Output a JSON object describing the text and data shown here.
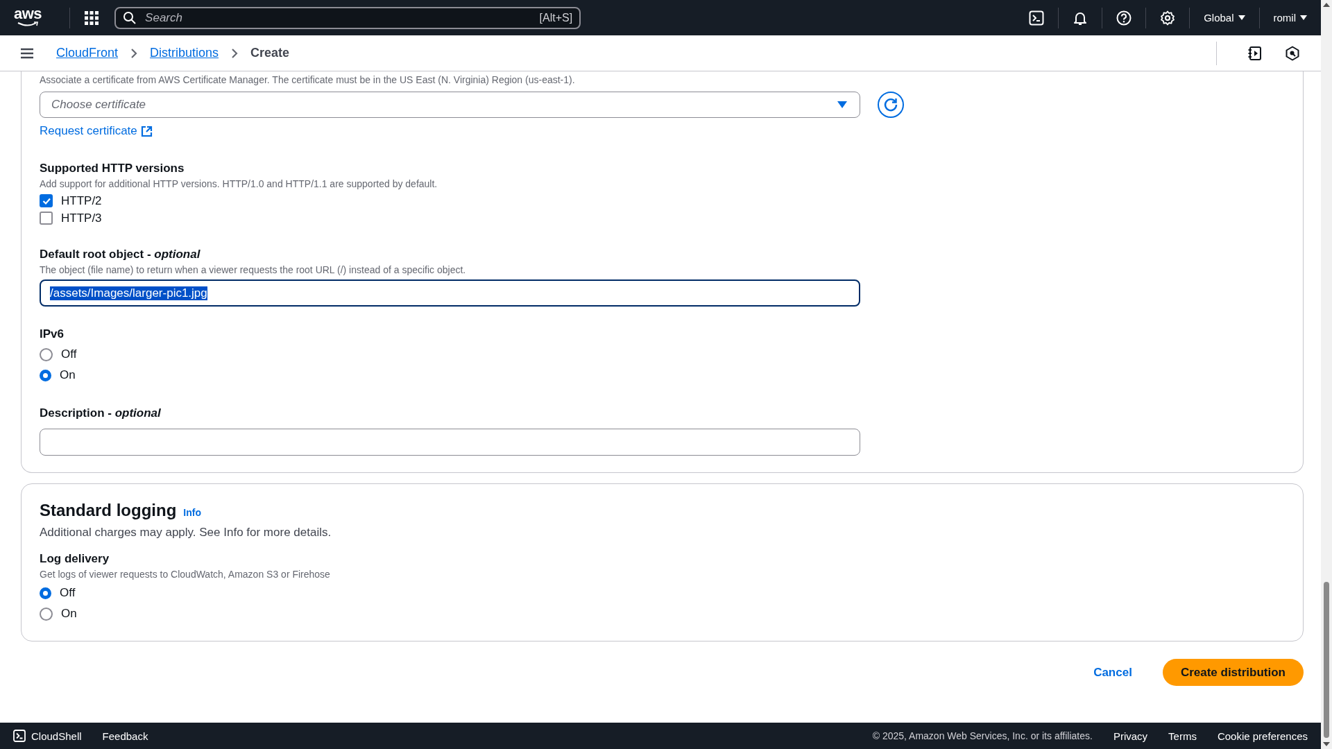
{
  "top_nav": {
    "logo": "aws",
    "search": {
      "placeholder": "Search",
      "shortcut": "[Alt+S]"
    },
    "region": "Global",
    "user": "romil"
  },
  "breadcrumbs": [
    {
      "label": "CloudFront",
      "kind": "link"
    },
    {
      "label": "Distributions",
      "kind": "link"
    },
    {
      "label": "Create",
      "kind": "current"
    }
  ],
  "settings_panel": {
    "certificate": {
      "description": "Associate a certificate from AWS Certificate Manager. The certificate must be in the US East (N. Virginia) Region (us-east-1).",
      "placeholder": "Choose certificate",
      "request_link": "Request certificate"
    },
    "http_versions": {
      "label": "Supported HTTP versions",
      "description": "Add support for additional HTTP versions. HTTP/1.0 and HTTP/1.1 are supported by default.",
      "options": [
        {
          "label": "HTTP/2",
          "checked": true
        },
        {
          "label": "HTTP/3",
          "checked": false
        }
      ]
    },
    "default_root_object": {
      "label": "Default root object - *optional*",
      "description": "The object (file name) to return when a viewer requests the root URL (/) instead of a specific object.",
      "value": "/assets/Images/larger-pic1.jpg",
      "text_selected": true
    },
    "ipv6": {
      "label": "IPv6",
      "options": [
        {
          "label": "Off",
          "selected": false
        },
        {
          "label": "On",
          "selected": true
        }
      ]
    },
    "description_field": {
      "label": "Description - *optional*"
    }
  },
  "standard_logging": {
    "title": "Standard logging",
    "info": "Info",
    "description": "Additional charges may apply. See Info for more details.",
    "log_delivery": {
      "label": "Log delivery",
      "description": "Get logs of viewer requests to CloudWatch, Amazon S3 or Firehose",
      "options": [
        {
          "label": "Off",
          "selected": true
        },
        {
          "label": "On",
          "selected": false
        }
      ]
    }
  },
  "actions": [
    {
      "label": "Cancel",
      "kind": "link"
    },
    {
      "label": "Create distribution",
      "kind": "primary"
    }
  ],
  "footer": {
    "cloudshell": "CloudShell",
    "feedback": "Feedback",
    "copyright": "© 2025, Amazon Web Services, Inc. or its affiliates.",
    "links": [
      "Privacy",
      "Terms",
      "Cookie preferences"
    ]
  }
}
